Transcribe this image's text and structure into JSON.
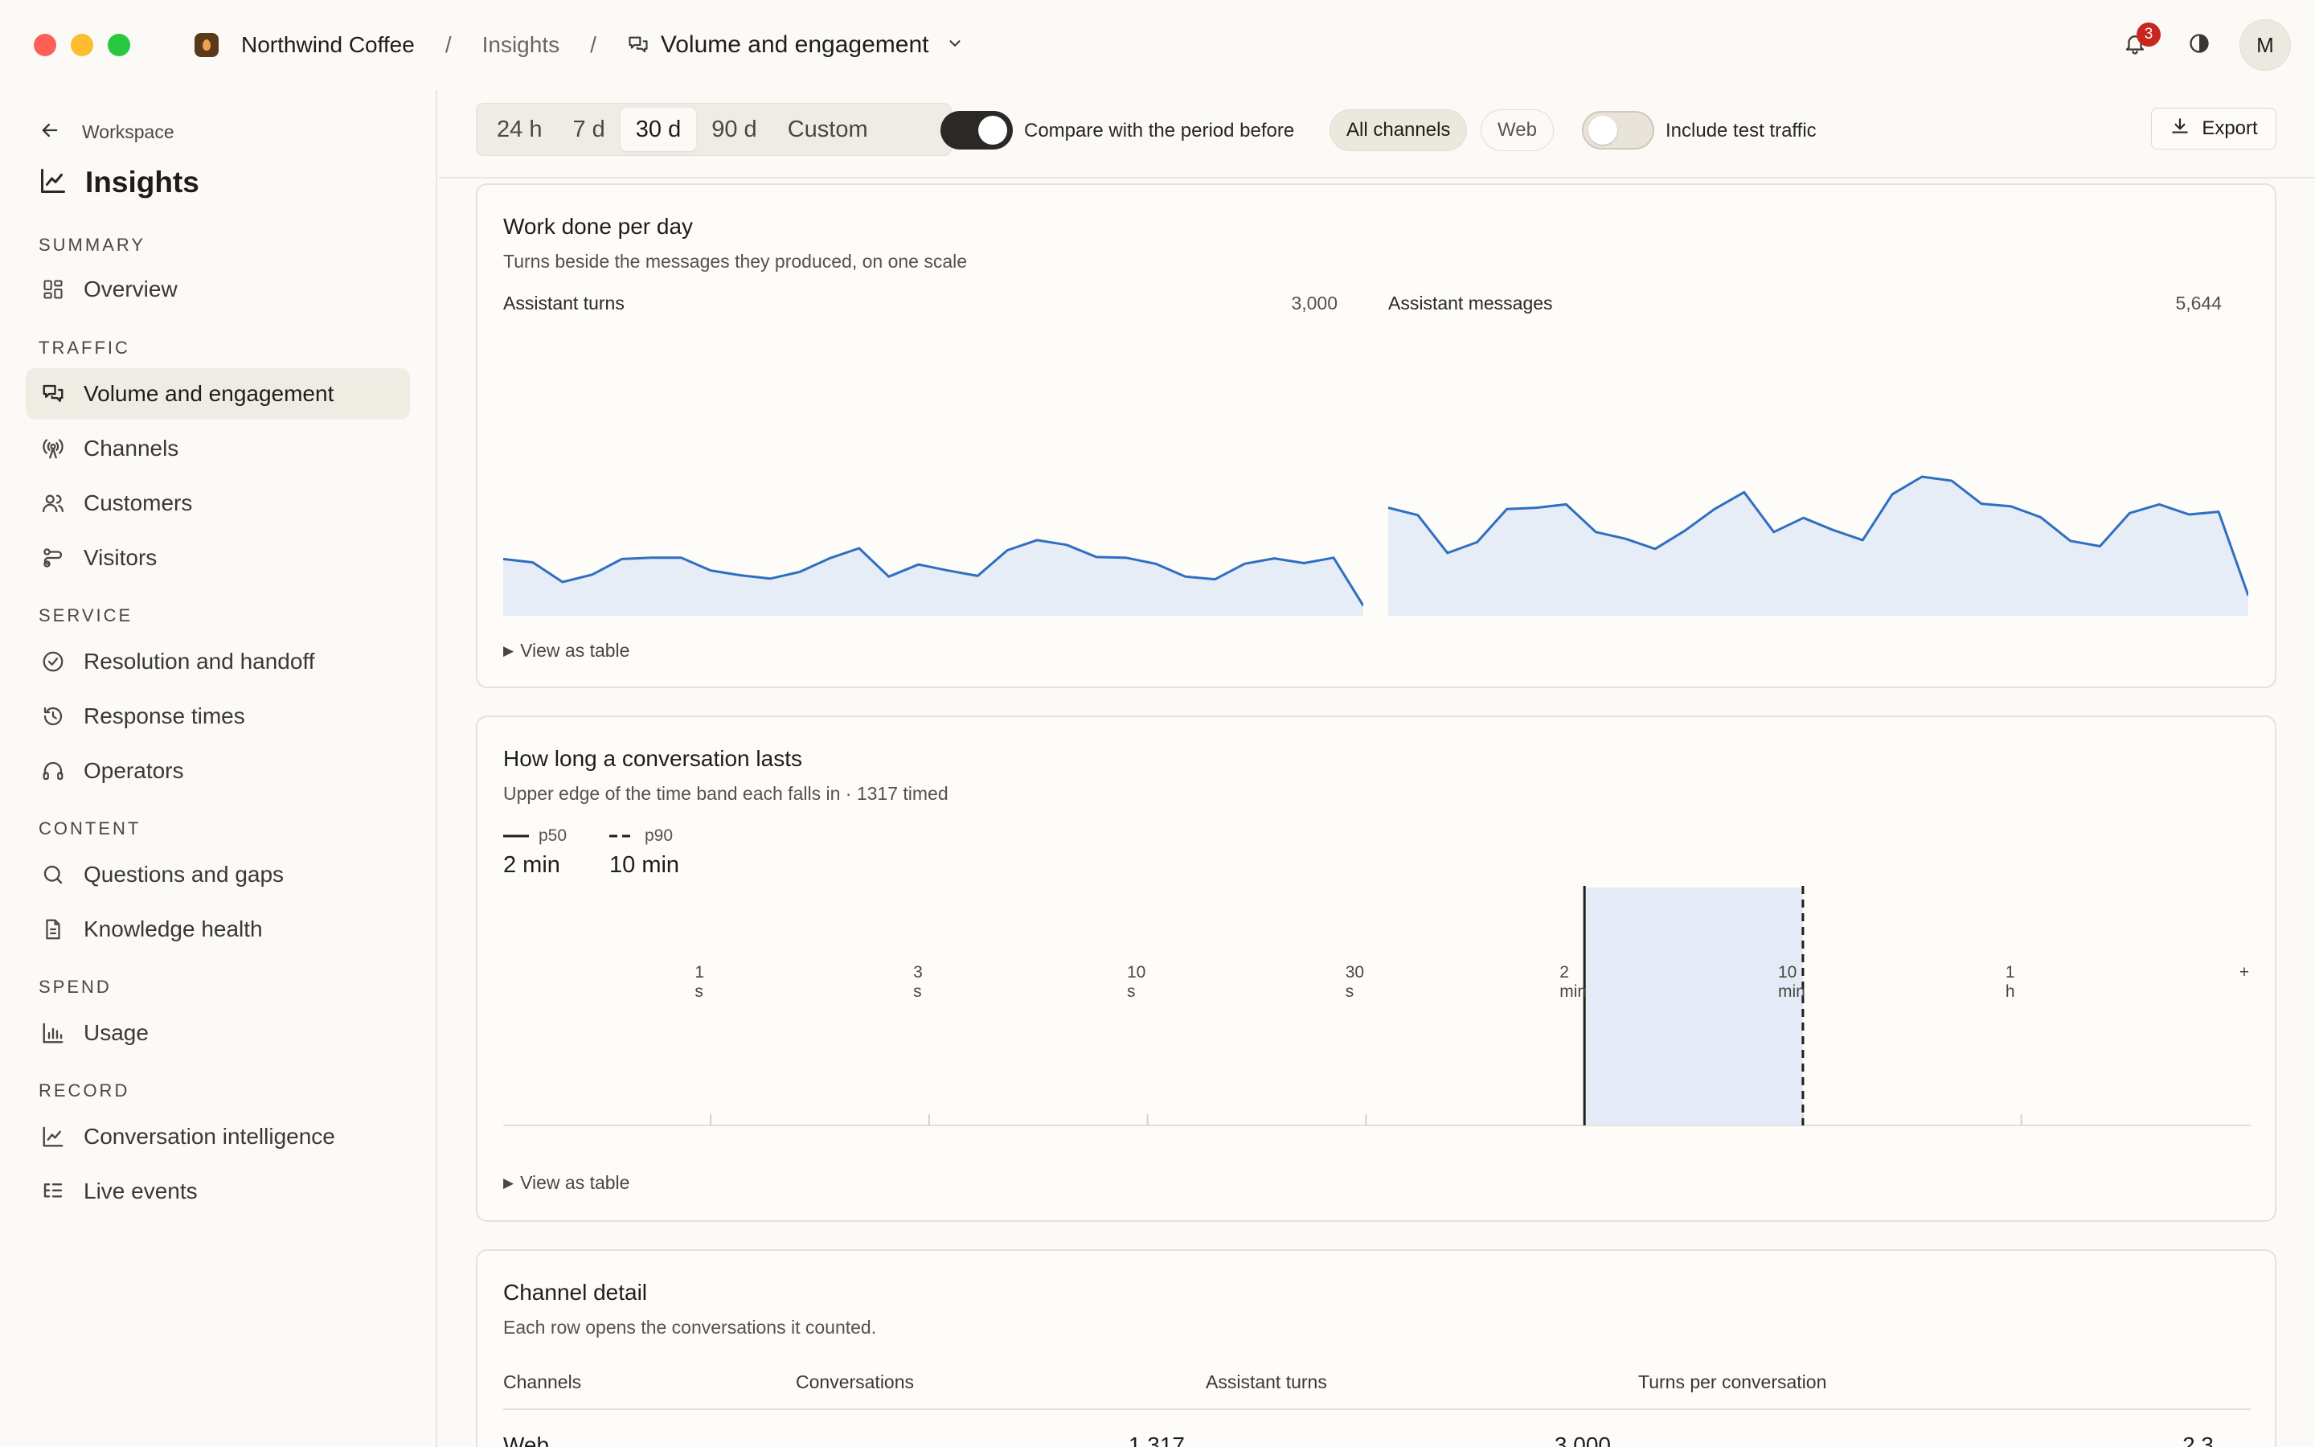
{
  "app": {
    "brand": "Northwind Coffee",
    "crumb": "Insights",
    "current_page": "Volume and engagement",
    "notification_count": "3",
    "avatar_initial": "M"
  },
  "sidebar": {
    "back_label": "Workspace",
    "title": "Insights",
    "sections": [
      {
        "heading": "SUMMARY",
        "items": [
          {
            "label": "Overview",
            "icon": "grid-icon"
          }
        ]
      },
      {
        "heading": "TRAFFIC",
        "items": [
          {
            "label": "Volume and engagement",
            "icon": "chat-bubbles-icon",
            "active": true
          },
          {
            "label": "Channels",
            "icon": "antenna-icon"
          },
          {
            "label": "Customers",
            "icon": "users-icon"
          },
          {
            "label": "Visitors",
            "icon": "route-icon"
          }
        ]
      },
      {
        "heading": "SERVICE",
        "items": [
          {
            "label": "Resolution and handoff",
            "icon": "check-circle-icon"
          },
          {
            "label": "Response times",
            "icon": "history-icon"
          },
          {
            "label": "Operators",
            "icon": "headset-icon"
          }
        ]
      },
      {
        "heading": "CONTENT",
        "items": [
          {
            "label": "Questions and gaps",
            "icon": "search-icon"
          },
          {
            "label": "Knowledge health",
            "icon": "document-icon"
          }
        ]
      },
      {
        "heading": "SPEND",
        "items": [
          {
            "label": "Usage",
            "icon": "bar-chart-icon"
          }
        ]
      },
      {
        "heading": "RECORD",
        "items": [
          {
            "label": "Conversation intelligence",
            "icon": "line-chart-icon"
          },
          {
            "label": "Live events",
            "icon": "list-tree-icon"
          }
        ]
      }
    ]
  },
  "toolbar": {
    "ranges": [
      "24 h",
      "7 d",
      "30 d",
      "90 d",
      "Custom"
    ],
    "selected_range": "30 d",
    "compare_label": "Compare with the period before",
    "compare_on": true,
    "channels": [
      "All channels",
      "Web"
    ],
    "selected_channel": "All channels",
    "test_traffic_label": "Include test traffic",
    "test_traffic_on": false,
    "export_label": "Export"
  },
  "work_card": {
    "title": "Work done per day",
    "subtitle": "Turns beside the messages they produced, on one scale",
    "view_table": "View as table"
  },
  "duration_card": {
    "title": "How long a conversation lasts",
    "subtitle": "Upper edge of the time band each falls in · 1317 timed",
    "legend": [
      {
        "key": "p50",
        "value": "2 min"
      },
      {
        "key": "p90",
        "value": "10 min"
      }
    ],
    "view_table": "View as table"
  },
  "channel_card": {
    "title": "Channel detail",
    "subtitle": "Each row opens the conversations it counted.",
    "columns": [
      "Channels",
      "Conversations",
      "Assistant turns",
      "Turns per conversation"
    ],
    "rows": [
      {
        "channel": "Web",
        "conversations": "1,317",
        "turns": "3,000",
        "ratio": "2.3"
      }
    ]
  },
  "chart_data": [
    {
      "type": "area",
      "title": "Assistant turns",
      "total_label": "3,000",
      "x": [
        1,
        2,
        3,
        4,
        5,
        6,
        7,
        8,
        9,
        10,
        11,
        12,
        13,
        14,
        15,
        16,
        17,
        18,
        19,
        20,
        21,
        22,
        23,
        24,
        25,
        26,
        27,
        28,
        29,
        30
      ],
      "values": [
        84,
        79,
        50,
        61,
        84,
        86,
        86,
        67,
        60,
        55,
        65,
        85,
        100,
        58,
        76,
        67,
        59,
        97,
        112,
        105,
        87,
        86,
        77,
        58,
        54,
        77,
        85,
        78,
        86,
        15
      ],
      "ylim": [
        0,
        400
      ],
      "color": "#2f6fc1",
      "fill": "#e6edf7"
    },
    {
      "type": "area",
      "title": "Assistant messages",
      "total_label": "5,644",
      "x": [
        1,
        2,
        3,
        4,
        5,
        6,
        7,
        8,
        9,
        10,
        11,
        12,
        13,
        14,
        15,
        16,
        17,
        18,
        19,
        20,
        21,
        22,
        23,
        24,
        25,
        26,
        27,
        28,
        29,
        30
      ],
      "values": [
        160,
        149,
        93,
        109,
        158,
        160,
        165,
        124,
        114,
        99,
        126,
        158,
        183,
        124,
        145,
        127,
        112,
        180,
        206,
        200,
        166,
        162,
        146,
        111,
        103,
        152,
        165,
        150,
        154,
        30
      ],
      "ylim": [
        0,
        400
      ],
      "color": "#2f6fc1",
      "fill": "#e6edf7"
    },
    {
      "type": "histogram",
      "xlabel_ticks": [
        "1 s",
        "3 s",
        "10 s",
        "30 s",
        "2 min",
        "10 min",
        "1 h",
        "+"
      ],
      "bands": [
        {
          "upper": "1 s",
          "count": 0
        },
        {
          "upper": "3 s",
          "count": 0
        },
        {
          "upper": "10 s",
          "count": 0
        },
        {
          "upper": "30 s",
          "count": 0
        },
        {
          "upper": "2 min",
          "count": 0
        },
        {
          "upper": "10 min",
          "count": 1317
        },
        {
          "upper": "1 h",
          "count": 0
        },
        {
          "upper": "+",
          "count": 0
        }
      ],
      "p50": "2 min",
      "p90": "10 min",
      "total": 1317
    }
  ]
}
